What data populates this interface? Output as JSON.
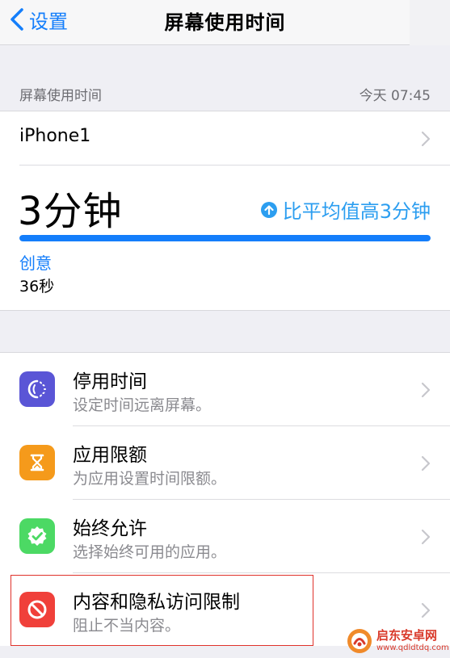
{
  "nav": {
    "back_label": "设置",
    "title": "屏幕使用时间"
  },
  "section_header": {
    "label": "屏幕使用时间",
    "timestamp": "今天 07:45"
  },
  "summary": {
    "device_name": "iPhone1",
    "total_time": "3分钟",
    "comparison": "比平均值高3分钟",
    "usage_bar_fraction": 1.0,
    "category_label": "创意",
    "category_value": "36秒",
    "accent_color": "#147efb",
    "comparison_color": "#2c9ef0"
  },
  "rows": [
    {
      "title": "停用时间",
      "subtitle": "设定时间远离屏幕。",
      "icon": "downtime-icon",
      "color": "#5a55d6"
    },
    {
      "title": "应用限额",
      "subtitle": "为应用设置时间限额。",
      "icon": "hourglass-icon",
      "color": "#f59a1b"
    },
    {
      "title": "始终允许",
      "subtitle": "选择始终可用的应用。",
      "icon": "check-badge-icon",
      "color": "#4cd964"
    },
    {
      "title": "内容和隐私访问限制",
      "subtitle": "阻止不当内容。",
      "icon": "no-entry-icon",
      "color": "#f0403a"
    }
  ],
  "watermark": {
    "name": "启东安卓网",
    "url": "www.qdldtdq.com"
  }
}
